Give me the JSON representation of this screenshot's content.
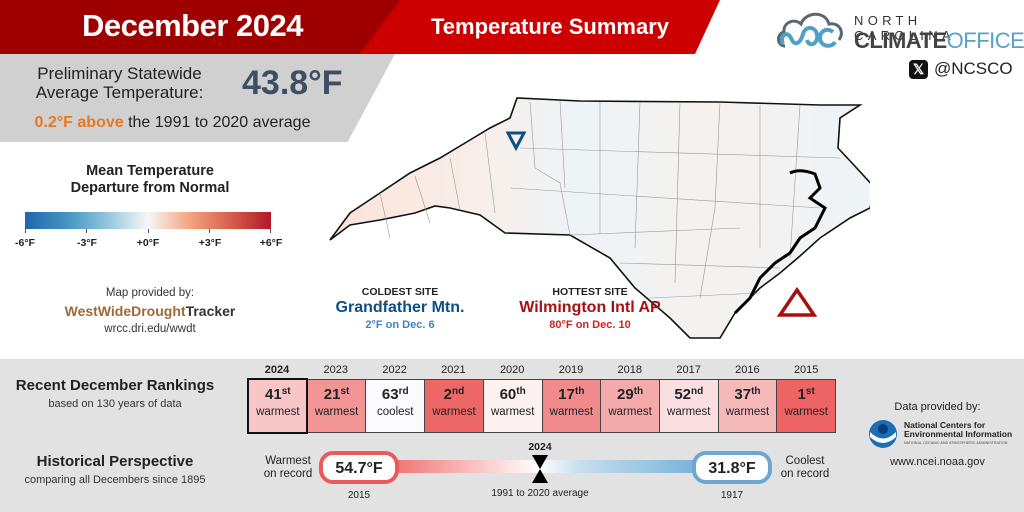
{
  "header": {
    "title": "December 2024",
    "subtitle": "Temperature Summary"
  },
  "summary": {
    "label": "Preliminary Statewide Average Temperature:",
    "value": "43.8°F",
    "anomaly_highlight": "0.2°F above",
    "anomaly_rest": " the 1991 to 2020 average"
  },
  "logo": {
    "top": "NORTH CAROLINA",
    "bold": "CLIMATE",
    "light": "OFFICE",
    "social_icon": "x-icon",
    "handle": "@NCSCO"
  },
  "legend": {
    "title_line1": "Mean Temperature",
    "title_line2": "Departure from Normal",
    "ticks": [
      "-6°F",
      "-3°F",
      "+0°F",
      "+3°F",
      "+6°F"
    ],
    "colors": [
      "#2166ac",
      "#f7f7f7",
      "#b2182b"
    ]
  },
  "map_credit": {
    "label": "Map provided by:",
    "brand_a": "WestWideDrought",
    "brand_b": "Tracker",
    "url": "wrcc.dri.edu/wwdt"
  },
  "coldest": {
    "heading": "COLDEST SITE",
    "name": "Grandfather Mtn.",
    "detail": "2°F on Dec. 6",
    "marker_icon": "down-triangle-icon",
    "color": "#0d4f82"
  },
  "hottest": {
    "heading": "HOTTEST SITE",
    "name": "Wilmington Intl AP",
    "detail": "80°F on Dec. 10",
    "marker_icon": "up-triangle-icon",
    "color": "#a81010"
  },
  "rankings": {
    "title": "Recent December Rankings",
    "subtitle": "based on 130 years of data",
    "items": [
      {
        "year": "2024",
        "rank": "41",
        "suffix": "st",
        "desc": "warmest",
        "color": "#f8c6c6"
      },
      {
        "year": "2023",
        "rank": "21",
        "suffix": "st",
        "desc": "warmest",
        "color": "#f29494"
      },
      {
        "year": "2022",
        "rank": "63",
        "suffix": "rd",
        "desc": "coolest",
        "color": "#fafaff"
      },
      {
        "year": "2021",
        "rank": "2",
        "suffix": "nd",
        "desc": "warmest",
        "color": "#ee6767"
      },
      {
        "year": "2020",
        "rank": "60",
        "suffix": "th",
        "desc": "warmest",
        "color": "#fdf1f1"
      },
      {
        "year": "2019",
        "rank": "17",
        "suffix": "th",
        "desc": "warmest",
        "color": "#f18b8b"
      },
      {
        "year": "2018",
        "rank": "29",
        "suffix": "th",
        "desc": "warmest",
        "color": "#f4aaaa"
      },
      {
        "year": "2017",
        "rank": "52",
        "suffix": "nd",
        "desc": "warmest",
        "color": "#fbdfe0"
      },
      {
        "year": "2016",
        "rank": "37",
        "suffix": "th",
        "desc": "warmest",
        "color": "#f6b9b9"
      },
      {
        "year": "2015",
        "rank": "1",
        "suffix": "st",
        "desc": "warmest",
        "color": "#ee6464"
      }
    ]
  },
  "history": {
    "title": "Historical Perspective",
    "subtitle": "comparing all Decembers since 1895",
    "warmest_label_1": "Warmest",
    "warmest_label_2": "on record",
    "warmest_value": "54.7°F",
    "warmest_year": "2015",
    "coolest_label_1": "Coolest",
    "coolest_label_2": "on record",
    "coolest_value": "31.8°F",
    "coolest_year": "1917",
    "marker_label": "2024",
    "marker_caption": "1991 to 2020 average"
  },
  "data_credit": {
    "label": "Data provided by:",
    "org_line1": "National Centers for",
    "org_line2": "Environmental Information",
    "org_small": "NATIONAL OCEANIC AND ATMOSPHERIC ADMINISTRATION",
    "url": "www.ncei.noaa.gov"
  }
}
